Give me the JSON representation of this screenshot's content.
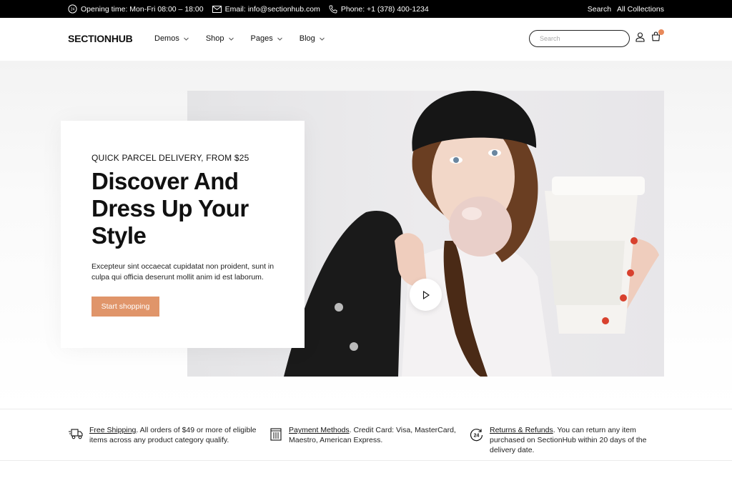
{
  "topbar": {
    "opening": "Opening time: Mon-Fri 08:00 – 18:00",
    "email": "Email: info@sectionhub.com",
    "phone": "Phone: +1 (378) 400-1234",
    "search_link": "Search",
    "collections_link": "All Collections"
  },
  "header": {
    "logo": "SECTIONHUB",
    "nav": [
      {
        "label": "Demos",
        "icon": "chevron-down-icon"
      },
      {
        "label": "Shop",
        "icon": "chevron-down-icon"
      },
      {
        "label": "Pages",
        "icon": "chevron-down-icon"
      },
      {
        "label": "Blog",
        "icon": "chevron-down-icon"
      }
    ],
    "search_placeholder": "Search",
    "icons": [
      "user-icon",
      "cart-icon"
    ]
  },
  "hero": {
    "eyebrow": "QUICK PARCEL DELIVERY, FROM $25",
    "headline": "Discover And Dress Up Your Style",
    "body": "Excepteur sint occaecat cupidatat non proident, sunt in culpa qui officia deserunt mollit anim id est laborum.",
    "cta": "Start shopping"
  },
  "features": [
    {
      "icon": "shipping-icon",
      "title": "Free Shipping",
      "text": ". All orders of $49 or more of eligible items across any product category qualify."
    },
    {
      "icon": "payment-icon",
      "title": "Payment Methods",
      "text": ". Credit Card: Visa, MasterCard, Maestro, American Express."
    },
    {
      "icon": "returns-24-icon",
      "title": "Returns & Refunds",
      "text": ". You can return any item purchased on SectionHub within 20 days of the delivery date."
    }
  ],
  "colors": {
    "accent": "#e0956a",
    "topbar_bg": "#000000",
    "cart_badge": "#e8895a"
  }
}
